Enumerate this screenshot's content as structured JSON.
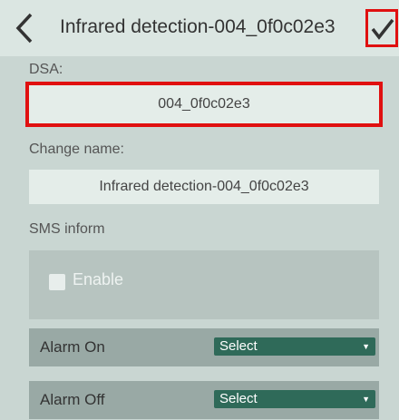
{
  "header": {
    "title": "Infrared detection-004_0f0c02e3"
  },
  "dsa": {
    "label": "DSA:",
    "value": "004_0f0c02e3"
  },
  "change_name": {
    "label": "Change name:",
    "value": "Infrared detection-004_0f0c02e3"
  },
  "sms": {
    "label": "SMS inform",
    "enable_label": "Enable"
  },
  "alarm_on": {
    "label": "Alarm On",
    "select_value": "Select"
  },
  "alarm_off": {
    "label": "Alarm Off",
    "select_value": "Select"
  },
  "colors": {
    "highlight": "#e01010",
    "select_bg": "#2f6a59",
    "background": "#c9d6d2"
  }
}
